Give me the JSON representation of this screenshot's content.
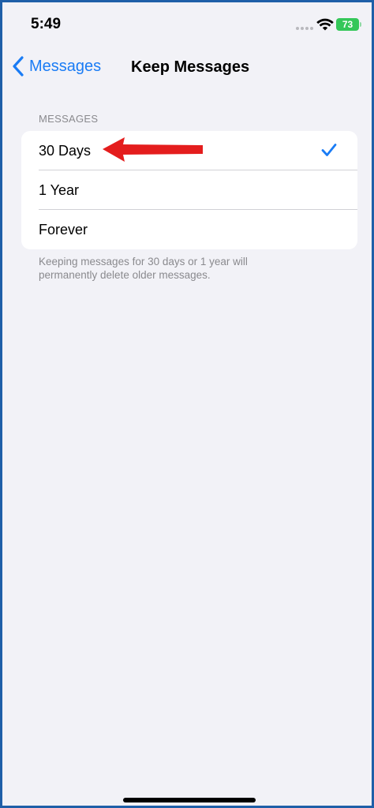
{
  "status_bar": {
    "time": "5:49",
    "battery_level": "73",
    "battery_color": "#34c759"
  },
  "nav": {
    "back_label": "Messages",
    "title": "Keep Messages"
  },
  "section": {
    "header": "MESSAGES",
    "options": [
      {
        "label": "30 Days",
        "selected": true
      },
      {
        "label": "1 Year",
        "selected": false
      },
      {
        "label": "Forever",
        "selected": false
      }
    ],
    "footer": "Keeping messages for 30 days or 1 year will permanently delete older messages."
  },
  "colors": {
    "accent": "#1a7cf5",
    "annotation": "#e41d1d",
    "background": "#f2f2f7"
  },
  "icons": {
    "back": "chevron-left-icon",
    "selected": "checkmark-icon",
    "annotation": "red-arrow-icon",
    "wifi": "wifi-icon",
    "signal": "signal-icon",
    "battery": "battery-icon"
  }
}
